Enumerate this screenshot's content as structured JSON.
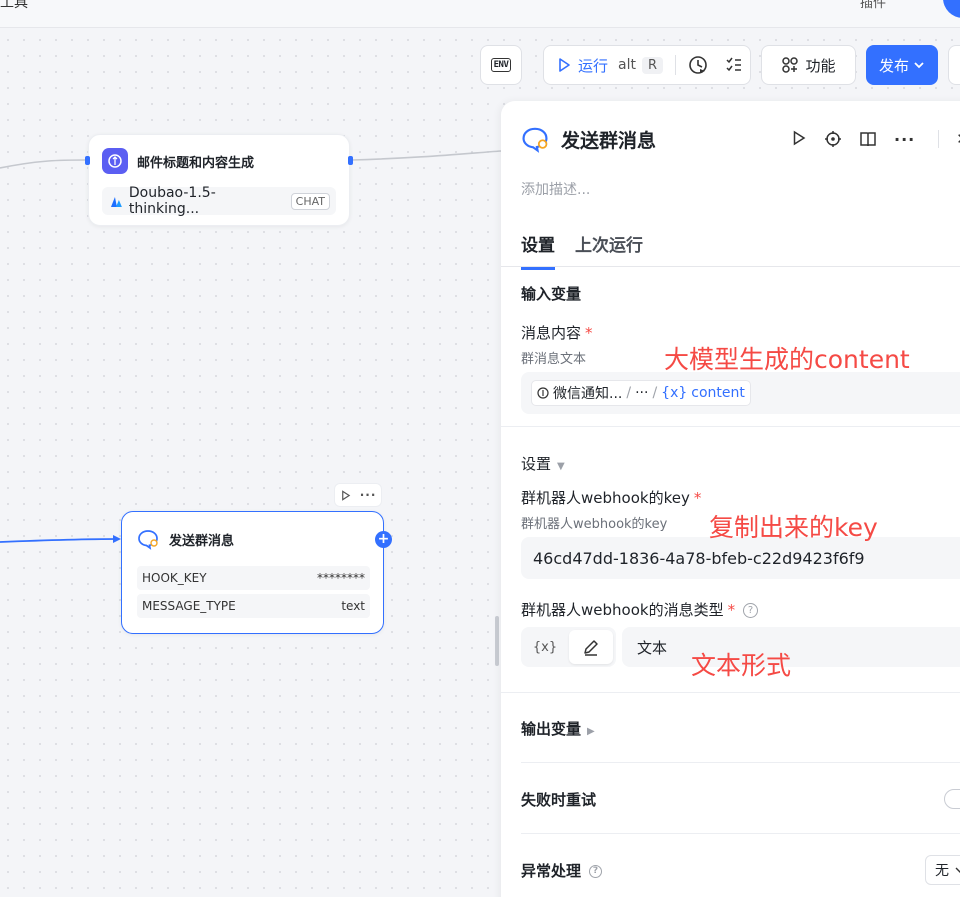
{
  "topbar": {
    "title_partial": "工具",
    "plugin_label": "插件"
  },
  "toolbar": {
    "env_label": "ENV",
    "run_label": "运行",
    "run_shortcut_mod": "alt",
    "run_shortcut_key": "R",
    "func_label": "功能",
    "publish_label": "发布"
  },
  "nodes": {
    "llm": {
      "title": "邮件标题和内容生成",
      "model": "Doubao-1.5-thinking...",
      "model_tag": "CHAT"
    },
    "send": {
      "title": "发送群消息",
      "params": [
        {
          "key": "HOOK_KEY",
          "value": "********"
        },
        {
          "key": "MESSAGE_TYPE",
          "value": "text"
        }
      ]
    }
  },
  "panel": {
    "title": "发送群消息",
    "description_placeholder": "添加描述...",
    "tabs": [
      {
        "label": "设置",
        "active": true
      },
      {
        "label": "上次运行",
        "active": false
      }
    ],
    "input_section": {
      "label": "输入变量",
      "message_field": {
        "label": "消息内容",
        "hint": "群消息文本",
        "ref_node": "微信通知...",
        "ref_path": "···",
        "ref_var_prefix": "{x}",
        "ref_var": "content"
      }
    },
    "settings_section": {
      "label": "设置",
      "webhook_key_field": {
        "label": "群机器人webhook的key",
        "hint": "群机器人webhook的key",
        "value": "46cd47dd-1836-4a78-bfeb-c22d9423f6f9"
      },
      "msg_type_field": {
        "label": "群机器人webhook的消息类型",
        "var_toggle": "{x}",
        "value": "文本"
      }
    },
    "output_section": {
      "label": "输出变量"
    },
    "retry_section": {
      "label": "失败时重试"
    },
    "exception_section": {
      "label": "异常处理",
      "value": "无"
    }
  },
  "annotations": {
    "content": "大模型生成的content",
    "key": "复制出来的key",
    "text_form": "文本形式"
  },
  "colors": {
    "accent": "#3370ff",
    "annotation": "#f54a45",
    "required": "#f54a45"
  }
}
